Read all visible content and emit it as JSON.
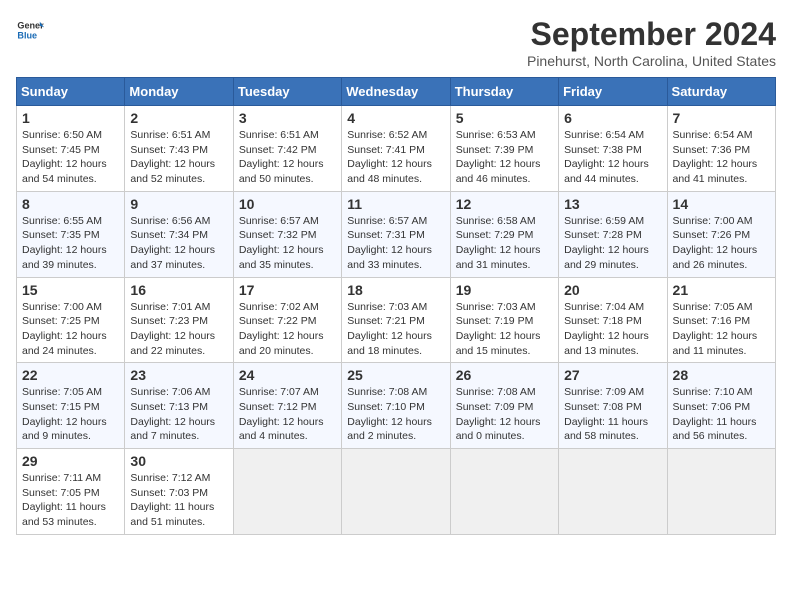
{
  "logo": {
    "text_general": "General",
    "text_blue": "Blue"
  },
  "calendar": {
    "title": "September 2024",
    "subtitle": "Pinehurst, North Carolina, United States"
  },
  "weekdays": [
    "Sunday",
    "Monday",
    "Tuesday",
    "Wednesday",
    "Thursday",
    "Friday",
    "Saturday"
  ],
  "weeks": [
    [
      {
        "day": "1",
        "info": "Sunrise: 6:50 AM\nSunset: 7:45 PM\nDaylight: 12 hours\nand 54 minutes."
      },
      {
        "day": "2",
        "info": "Sunrise: 6:51 AM\nSunset: 7:43 PM\nDaylight: 12 hours\nand 52 minutes."
      },
      {
        "day": "3",
        "info": "Sunrise: 6:51 AM\nSunset: 7:42 PM\nDaylight: 12 hours\nand 50 minutes."
      },
      {
        "day": "4",
        "info": "Sunrise: 6:52 AM\nSunset: 7:41 PM\nDaylight: 12 hours\nand 48 minutes."
      },
      {
        "day": "5",
        "info": "Sunrise: 6:53 AM\nSunset: 7:39 PM\nDaylight: 12 hours\nand 46 minutes."
      },
      {
        "day": "6",
        "info": "Sunrise: 6:54 AM\nSunset: 7:38 PM\nDaylight: 12 hours\nand 44 minutes."
      },
      {
        "day": "7",
        "info": "Sunrise: 6:54 AM\nSunset: 7:36 PM\nDaylight: 12 hours\nand 41 minutes."
      }
    ],
    [
      {
        "day": "8",
        "info": "Sunrise: 6:55 AM\nSunset: 7:35 PM\nDaylight: 12 hours\nand 39 minutes."
      },
      {
        "day": "9",
        "info": "Sunrise: 6:56 AM\nSunset: 7:34 PM\nDaylight: 12 hours\nand 37 minutes."
      },
      {
        "day": "10",
        "info": "Sunrise: 6:57 AM\nSunset: 7:32 PM\nDaylight: 12 hours\nand 35 minutes."
      },
      {
        "day": "11",
        "info": "Sunrise: 6:57 AM\nSunset: 7:31 PM\nDaylight: 12 hours\nand 33 minutes."
      },
      {
        "day": "12",
        "info": "Sunrise: 6:58 AM\nSunset: 7:29 PM\nDaylight: 12 hours\nand 31 minutes."
      },
      {
        "day": "13",
        "info": "Sunrise: 6:59 AM\nSunset: 7:28 PM\nDaylight: 12 hours\nand 29 minutes."
      },
      {
        "day": "14",
        "info": "Sunrise: 7:00 AM\nSunset: 7:26 PM\nDaylight: 12 hours\nand 26 minutes."
      }
    ],
    [
      {
        "day": "15",
        "info": "Sunrise: 7:00 AM\nSunset: 7:25 PM\nDaylight: 12 hours\nand 24 minutes."
      },
      {
        "day": "16",
        "info": "Sunrise: 7:01 AM\nSunset: 7:23 PM\nDaylight: 12 hours\nand 22 minutes."
      },
      {
        "day": "17",
        "info": "Sunrise: 7:02 AM\nSunset: 7:22 PM\nDaylight: 12 hours\nand 20 minutes."
      },
      {
        "day": "18",
        "info": "Sunrise: 7:03 AM\nSunset: 7:21 PM\nDaylight: 12 hours\nand 18 minutes."
      },
      {
        "day": "19",
        "info": "Sunrise: 7:03 AM\nSunset: 7:19 PM\nDaylight: 12 hours\nand 15 minutes."
      },
      {
        "day": "20",
        "info": "Sunrise: 7:04 AM\nSunset: 7:18 PM\nDaylight: 12 hours\nand 13 minutes."
      },
      {
        "day": "21",
        "info": "Sunrise: 7:05 AM\nSunset: 7:16 PM\nDaylight: 12 hours\nand 11 minutes."
      }
    ],
    [
      {
        "day": "22",
        "info": "Sunrise: 7:05 AM\nSunset: 7:15 PM\nDaylight: 12 hours\nand 9 minutes."
      },
      {
        "day": "23",
        "info": "Sunrise: 7:06 AM\nSunset: 7:13 PM\nDaylight: 12 hours\nand 7 minutes."
      },
      {
        "day": "24",
        "info": "Sunrise: 7:07 AM\nSunset: 7:12 PM\nDaylight: 12 hours\nand 4 minutes."
      },
      {
        "day": "25",
        "info": "Sunrise: 7:08 AM\nSunset: 7:10 PM\nDaylight: 12 hours\nand 2 minutes."
      },
      {
        "day": "26",
        "info": "Sunrise: 7:08 AM\nSunset: 7:09 PM\nDaylight: 12 hours\nand 0 minutes."
      },
      {
        "day": "27",
        "info": "Sunrise: 7:09 AM\nSunset: 7:08 PM\nDaylight: 11 hours\nand 58 minutes."
      },
      {
        "day": "28",
        "info": "Sunrise: 7:10 AM\nSunset: 7:06 PM\nDaylight: 11 hours\nand 56 minutes."
      }
    ],
    [
      {
        "day": "29",
        "info": "Sunrise: 7:11 AM\nSunset: 7:05 PM\nDaylight: 11 hours\nand 53 minutes."
      },
      {
        "day": "30",
        "info": "Sunrise: 7:12 AM\nSunset: 7:03 PM\nDaylight: 11 hours\nand 51 minutes."
      },
      null,
      null,
      null,
      null,
      null
    ]
  ]
}
